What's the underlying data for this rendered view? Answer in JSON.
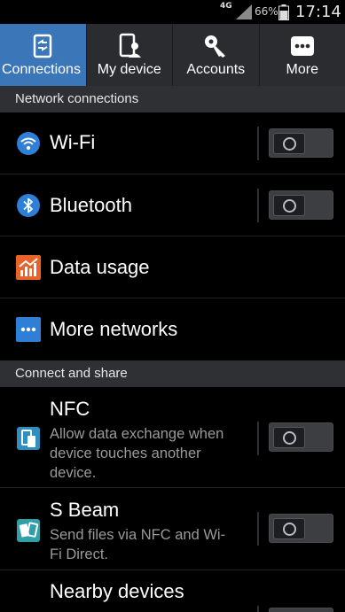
{
  "status_bar": {
    "network": "4G",
    "battery_percent": "66%",
    "time": "17:14"
  },
  "tabs": [
    {
      "label": "Connections",
      "icon": "connections-icon",
      "active": true
    },
    {
      "label": "My device",
      "icon": "my-device-icon",
      "active": false
    },
    {
      "label": "Accounts",
      "icon": "key-icon",
      "active": false
    },
    {
      "label": "More",
      "icon": "more-dots-icon",
      "active": false
    }
  ],
  "sections": {
    "network_connections": "Network connections",
    "connect_and_share": "Connect and share"
  },
  "rows": {
    "wifi": {
      "title": "Wi-Fi",
      "icon": "wifi-icon",
      "toggle": "off"
    },
    "bluetooth": {
      "title": "Bluetooth",
      "icon": "bluetooth-icon",
      "toggle": "off"
    },
    "data_usage": {
      "title": "Data usage",
      "icon": "data-usage-icon"
    },
    "more_networks": {
      "title": "More networks",
      "icon": "more-networks-icon"
    },
    "nfc": {
      "title": "NFC",
      "subtitle_lines": [
        "Allow data exchange when",
        "device touches another",
        "device."
      ],
      "icon": "nfc-icon",
      "toggle": "off"
    },
    "s_beam": {
      "title": "S Beam",
      "subtitle_lines": [
        "Send files via NFC and Wi-",
        "Fi Direct."
      ],
      "icon": "s-beam-icon",
      "toggle": "off"
    },
    "nearby_devices": {
      "title": "Nearby devices",
      "icon": "nearby-devices-icon"
    }
  },
  "colors": {
    "background": "#000000",
    "tab_bar": "#2a2c30",
    "tab_active": "#3a76b8",
    "section_header": "#2f3033",
    "subtitle_text": "#9a9a9a",
    "icon_blue": "#2f7fd6",
    "icon_orange": "#e8622a"
  }
}
